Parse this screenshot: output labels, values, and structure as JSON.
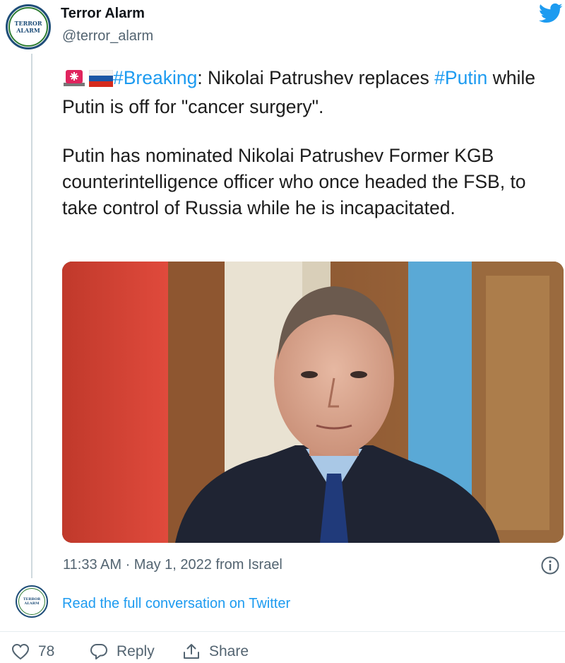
{
  "account": {
    "name": "Terror Alarm",
    "handle": "@terror_alarm",
    "avatar_text_top": "TERROR",
    "avatar_text_bottom": "ALARM"
  },
  "tweet": {
    "line1_hashtag_breaking": "#Breaking",
    "line1_text": ": Nikolai Patrushev replaces ",
    "line1_hashtag_putin": "#Putin",
    "line1_text_cont": " while Putin is off for \"cancer surgery\".",
    "paragraph2": "Putin has nominated Nikolai Patrushev Former KGB counterintelligence officer who once headed the FSB, to take control of Russia while he is incapacitated.",
    "emojis": [
      "police-car-light-icon",
      "russia-flag-icon"
    ]
  },
  "meta": {
    "timestamp": "11:33 AM · May 1, 2022 from Israel",
    "read_full": "Read the full conversation on Twitter"
  },
  "actions": {
    "like_count": "78",
    "reply_label": "Reply",
    "share_label": "Share"
  },
  "colors": {
    "accent": "#1d9bf0",
    "muted": "#536471",
    "divider": "#e6ecf0"
  }
}
